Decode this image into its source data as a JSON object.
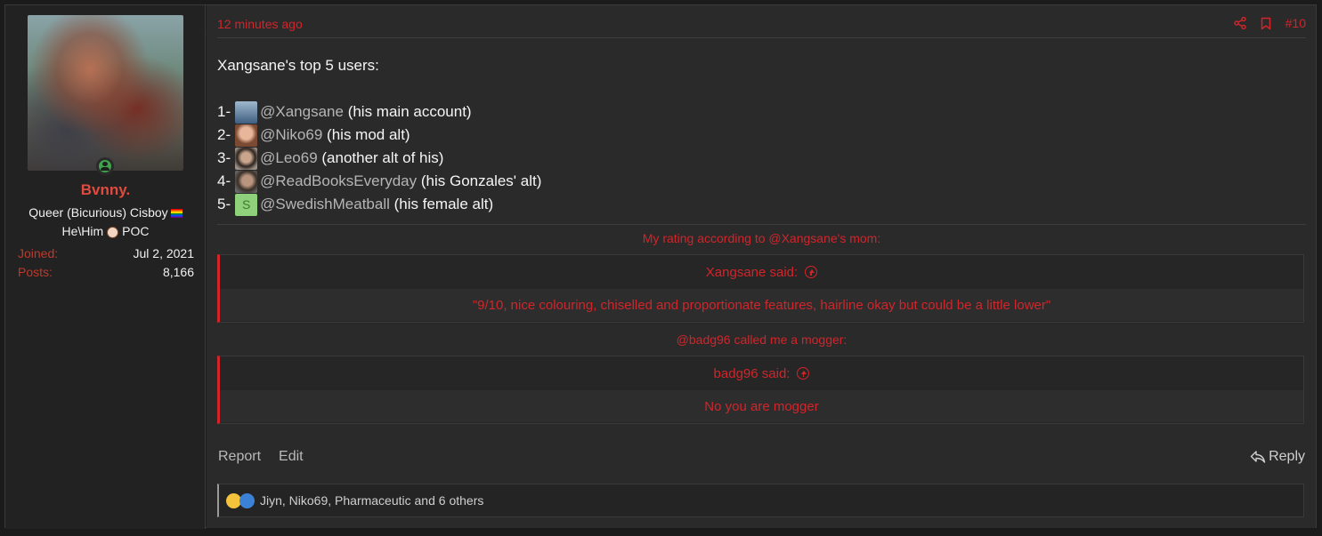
{
  "author": {
    "username": "Bvnny.",
    "title_line1": "Queer (Bicurious) Cisboy",
    "title_line2_a": "He\\Him",
    "title_line2_b": "POC",
    "joined_label": "Joined:",
    "joined_value": "Jul 2, 2021",
    "posts_label": "Posts:",
    "posts_value": "8,166"
  },
  "post": {
    "time": "12 minutes ago",
    "number": "#10",
    "intro": "Xangsane's top 5 users:",
    "users": [
      {
        "num": "1-",
        "mention": "@Xangsane",
        "note": "(his main account)",
        "avatar_color": "#4a6f94"
      },
      {
        "num": "2-",
        "mention": "@Niko69",
        "note": "(his mod alt)",
        "avatar_color": "#a06a4e"
      },
      {
        "num": "3-",
        "mention": "@Leo69",
        "note": "(another alt of his)",
        "avatar_color": "#6b5a4f"
      },
      {
        "num": "4-",
        "mention": "@ReadBooksEveryday",
        "note": "(his Gonzales' alt)",
        "avatar_color": "#5a5a5a"
      },
      {
        "num": "5-",
        "mention": "@SwedishMeatball",
        "note": "(his female alt)",
        "avatar_letter": "S",
        "avatar_color": "#8fd07a"
      }
    ],
    "note1": "My rating according to @Xangsane's mom:",
    "quote1": {
      "author": "Xangsane said:",
      "text": "\"9/10, nice colouring, chiselled and proportionate features, hairline okay but could be a little lower\""
    },
    "note2": "@badg96 called me a mogger:",
    "quote2": {
      "author": "badg96 said:",
      "text": "No you are mogger"
    },
    "actions": {
      "report": "Report",
      "edit": "Edit",
      "reply": "Reply"
    },
    "reactions_text": "Jiyn, Niko69, Pharmaceutic and 6 others"
  },
  "colors": {
    "accent": "#d1252a",
    "username": "#e04a3f",
    "online": "#3fa34d"
  }
}
